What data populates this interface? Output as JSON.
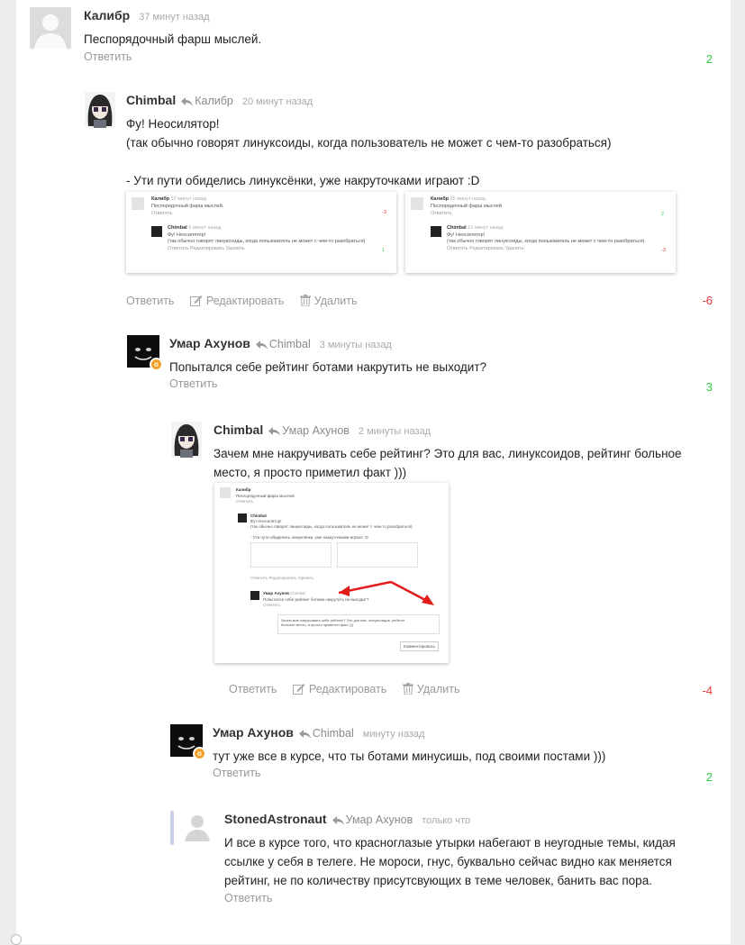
{
  "comments": [
    {
      "author": "Калибр",
      "reply_to": "",
      "time": "37 минут назад",
      "lines": [
        "Песпорядочный фарш мыслей."
      ],
      "actions": [
        "Ответить"
      ],
      "score": "2"
    },
    {
      "author": "Chimbal",
      "reply_to": "Калибр",
      "time": "20 минут назад",
      "lines": [
        "Фу! Неосилятор!",
        "(так обычно говорят линуксоиды, когда пользователь не может с чем-то разобраться)",
        "",
        "- Ути пути обиделись линуксёнки, уже накруточками играют :D"
      ],
      "actions": [
        "Ответить",
        "Редактировать",
        "Удалить"
      ],
      "score": "-6"
    },
    {
      "author": "Умар Ахунов",
      "reply_to": "Chimbal",
      "time": "3 минуты назад",
      "lines": [
        "Попытался себе рейтинг ботами накрутить не выходит?"
      ],
      "actions": [
        "Ответить"
      ],
      "score": "3"
    },
    {
      "author": "Chimbal",
      "reply_to": "Умар Ахунов",
      "time": "2 минуты назад",
      "lines": [
        "Зачем мне накручивать себе рейтинг? Это для вас, линуксоидов, рейтинг больное",
        "место, я просто приметил факт )))"
      ],
      "actions": [
        "Ответить",
        "Редактировать",
        "Удалить"
      ],
      "score": "-4"
    },
    {
      "author": "Умар Ахунов",
      "reply_to": "Chimbal",
      "time": "минуту назад",
      "lines": [
        "тут уже все в курсе, что ты ботами минусишь, под своими постами )))"
      ],
      "actions": [
        "Ответить"
      ],
      "score": "2"
    },
    {
      "author": "StonedAstronaut",
      "reply_to": "Умар Ахунов",
      "time": "только что",
      "lines": [
        "И все в курсе того, что красноглазые утырки набегают в неугодные темы, кидая",
        "ссылке у себя в телеге. Не мороси, гнус, буквально сейчас видно как меняется",
        "рейтинг, не по количеству присутсвующих в теме человек, банить вас пора."
      ],
      "actions": [
        "Ответить"
      ],
      "score": ""
    }
  ],
  "badge_glyph": "о",
  "colors": {
    "positive": "#2ecc40",
    "negative": "#e53935",
    "thread_bar": "#c9cfe6",
    "badge": "#f2a12b"
  },
  "screenshot_left": {
    "c1_author": "Калибр",
    "c1_time": "37 минут назад",
    "c1_text": "Песпорядочный фарш мыслей.",
    "c1_reply": "Ответить",
    "c1_score": "-3",
    "c2_author": "Chimbal",
    "c2_time": "6 минут назад",
    "c2_line1": "Фу! Неосилятор!",
    "c2_line2": "(так обычно говорят линуксоиды, когда пользователь не может с чем-то разобраться)",
    "c2_actions": "Ответить   Редактировать   Удалить",
    "c2_score": "1"
  },
  "screenshot_right": {
    "c1_author": "Калибр",
    "c1_time": "25 минут назад",
    "c1_text": "Песпорядочный фарш мыслей",
    "c1_reply": "Ответить",
    "c1_score": "2",
    "c2_author": "Chimbal",
    "c2_time": "10 минут назад",
    "c2_line1": "Фу! Неосилятор!",
    "c2_line2": "(так обычно говорят линуксоиды, когда пользователь не может с чем-то разобраться)",
    "c2_actions": "Ответить   Редактировать   Удалить",
    "c2_score": "-3"
  },
  "screenshot_nested": {
    "c1_author": "Калибр",
    "c1_text": "Песпорядочный фарш мыслей.",
    "c1_reply": "Ответить",
    "c2_author": "Chimbal",
    "c2_line1": "Фу! Неосилятор!",
    "c2_line2": "(так обычно говорят линуксоиды, когда пользователь не может с чем-то разобраться)",
    "c2_line3": "- Ути пути обиделись линуксёнки, уже накруточками играют :D",
    "c2_actions": "Ответить   Редактировать   Удалить",
    "c3_author": "Умар Ахунов",
    "c3_reply_to": "Chimbal",
    "c3_text": "Попытался себе рейтинг ботами накрутить не выходит?",
    "c3_reply": "Ответить",
    "c4_text": "Зачем мне накручивать себе рейтинг? Это для вас, линуксоидов, рейтинг больное место, я просто приметил факт )))",
    "submit": "Комментировать"
  }
}
